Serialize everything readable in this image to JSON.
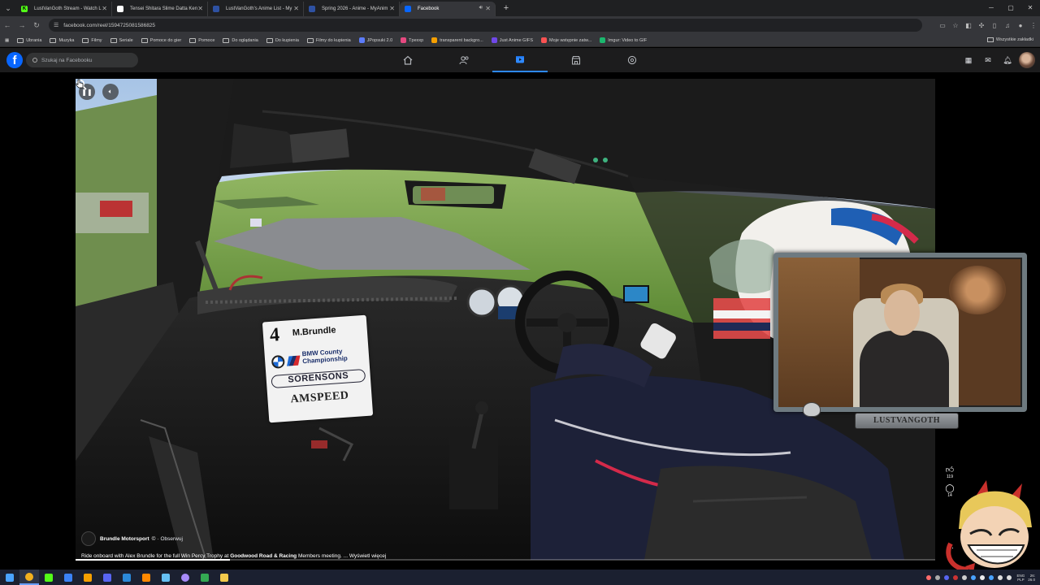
{
  "browser": {
    "tabs": [
      {
        "title": "LustVanGoth Stream - Watch L",
        "favicon": "K",
        "favicon_color": "#53fc18",
        "active": false
      },
      {
        "title": "Tensei Shitara Slime Datta Ken",
        "favicon": "",
        "favicon_color": "#ffffff",
        "active": false
      },
      {
        "title": "LustVanGoth's Anime List - My",
        "favicon": "",
        "favicon_color": "#2e51a2",
        "active": false
      },
      {
        "title": "Spring 2026 - Anime - MyAnim",
        "favicon": "",
        "favicon_color": "#2e51a2",
        "active": false
      },
      {
        "title": "Facebook",
        "favicon": "",
        "favicon_color": "#0866ff",
        "active": true
      }
    ],
    "url": "facebook.com/reel/1594725081586825",
    "bookmarks": [
      {
        "label": "Ubrania",
        "type": "folder"
      },
      {
        "label": "Muzyka",
        "type": "folder"
      },
      {
        "label": "Filmy",
        "type": "folder"
      },
      {
        "label": "Seriale",
        "type": "folder"
      },
      {
        "label": "Pomoce do gier",
        "type": "folder"
      },
      {
        "label": "Pomoce",
        "type": "folder"
      },
      {
        "label": "Do oglądania",
        "type": "folder"
      },
      {
        "label": "Do kupienia",
        "type": "folder"
      },
      {
        "label": "Filmy do kupienia",
        "type": "folder"
      },
      {
        "label": "JPopsuki 2.0",
        "type": "site",
        "color": "#5c7cfa"
      },
      {
        "label": "Tpexxp",
        "type": "site",
        "color": "#e64980"
      },
      {
        "label": "transparent backgro...",
        "type": "site",
        "color": "#f59f00"
      },
      {
        "label": "Just Anime GIFS",
        "type": "site",
        "color": "#7048e8"
      },
      {
        "label": "Moje wstępnie zatw...",
        "type": "site",
        "color": "#fa5252"
      },
      {
        "label": "Imgur: Video to GIF",
        "type": "site",
        "color": "#1bb76e"
      }
    ],
    "bookmarks_right": "Wszystkie zakładki"
  },
  "facebook": {
    "search_placeholder": "Szukaj na Facebooku",
    "nav": [
      {
        "icon": "home-icon",
        "active": false
      },
      {
        "icon": "friends-icon",
        "active": false
      },
      {
        "icon": "video-icon",
        "active": true
      },
      {
        "icon": "marketplace-icon",
        "active": false
      },
      {
        "icon": "gaming-icon",
        "active": false
      }
    ]
  },
  "reel": {
    "author": "Brundle Motorsport",
    "verified_mark": "©",
    "follow_label": "· Obserwuj",
    "description_prefix": "Ride onboard with Alex Brundle for the full Win Percy Trophy at ",
    "description_bold": "Goodwood Road & Racing",
    "description_suffix": " Members meeting. ...",
    "see_more": " Wyświetl więcej",
    "like_count": "119",
    "comment_count": "14",
    "progress": 0.18
  },
  "race_plate": {
    "number": "4",
    "driver": "M.Brundle",
    "series": "BMW County Championship",
    "sponsor_1": "SORENSONS",
    "sponsor_2": "AMSPEED"
  },
  "overlay": {
    "streamer_name": "LUSTVANGOTH"
  },
  "taskbar": {
    "apps": [
      {
        "name": "start-icon",
        "color": "#4aa3ff"
      },
      {
        "name": "chrome-icon",
        "color": "#f2b01e"
      },
      {
        "name": "kick-icon",
        "color": "#53fc18"
      },
      {
        "name": "browser-icon",
        "color": "#3b82f6"
      },
      {
        "name": "app-icon",
        "color": "#f59f00"
      },
      {
        "name": "discord-icon",
        "color": "#5865f2"
      },
      {
        "name": "store-icon",
        "color": "#2b88d8"
      },
      {
        "name": "vlc-icon",
        "color": "#ff8800"
      },
      {
        "name": "steam-icon",
        "color": "#66c0f4"
      },
      {
        "name": "obs-icon",
        "color": "#a78bfa"
      },
      {
        "name": "chrome2-icon",
        "color": "#34a853"
      },
      {
        "name": "folder-icon",
        "color": "#f2c94c"
      }
    ],
    "lang_top": "ENG",
    "lang_bottom": "PLP",
    "time": "26:",
    "date": "26.0"
  }
}
